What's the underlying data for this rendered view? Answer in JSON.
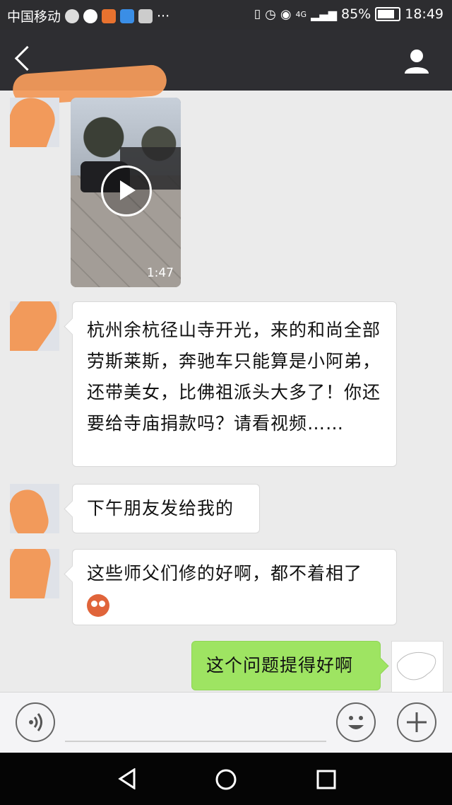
{
  "status_bar": {
    "carrier": "中国移动",
    "more": "···",
    "network": "4G",
    "battery_percent": "85%",
    "time": "18:49"
  },
  "chat": {
    "video_duration": "1:47",
    "messages": [
      {
        "text": "杭州余杭径山寺开光，来的和尚全部劳斯莱斯，奔驰车只能算是小阿弟，还带美女，比佛祖派头大多了！你还要给寺庙捐款吗？请看视频……"
      },
      {
        "text": "下午朋友发给我的"
      },
      {
        "text": "这些师父们修的好啊，都不着相了"
      },
      {
        "text": "这个问题提得好啊"
      }
    ]
  },
  "icons": {
    "back": "back-arrow-icon",
    "contact": "person-icon",
    "voice": "voice-icon",
    "emoji": "smiley-icon",
    "more": "plus-icon"
  }
}
